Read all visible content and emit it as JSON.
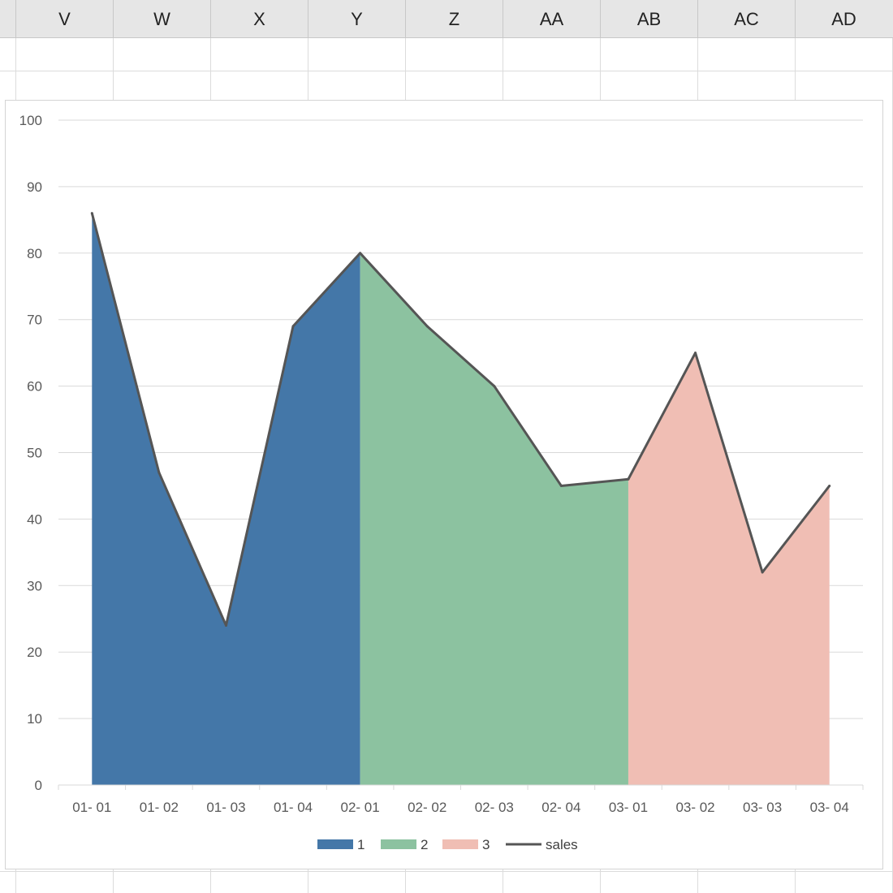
{
  "spreadsheet": {
    "columns": [
      "V",
      "W",
      "X",
      "Y",
      "Z",
      "AA",
      "AB",
      "AC",
      "AD"
    ]
  },
  "chart_data": {
    "type": "area",
    "categories": [
      "01- 01",
      "01- 02",
      "01- 03",
      "01- 04",
      "02- 01",
      "02- 02",
      "02- 03",
      "02- 04",
      "03- 01",
      "03- 02",
      "03- 03",
      "03- 04"
    ],
    "sales": [
      86,
      47,
      24,
      69,
      80,
      69,
      60,
      45,
      46,
      65,
      32,
      45
    ],
    "groups": [
      {
        "name": "1",
        "from": 0,
        "to": 4,
        "color": "#4477a8"
      },
      {
        "name": "2",
        "from": 4,
        "to": 8,
        "color": "#8cc2a0"
      },
      {
        "name": "3",
        "from": 8,
        "to": 11,
        "color": "#f0beb4"
      }
    ],
    "line_series": {
      "name": "sales",
      "color": "#555555"
    },
    "ylim": [
      0,
      100
    ],
    "yticks": [
      0,
      10,
      20,
      30,
      40,
      50,
      60,
      70,
      80,
      90,
      100
    ],
    "grid": true,
    "legend_position": "bottom"
  }
}
